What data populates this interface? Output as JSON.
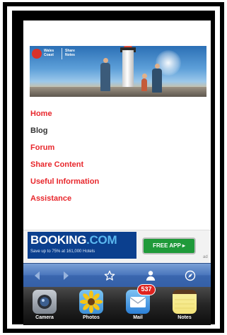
{
  "banner": {
    "logo_line1": "Wales",
    "logo_line2": "Coast",
    "share_line1": "Share",
    "share_line2": "Notes"
  },
  "nav": {
    "items": [
      {
        "label": "Home",
        "active": false
      },
      {
        "label": "Blog",
        "active": true
      },
      {
        "label": "Forum",
        "active": false
      },
      {
        "label": "Share Content",
        "active": false
      },
      {
        "label": "Useful Information",
        "active": false
      },
      {
        "label": "Assistance",
        "active": false
      }
    ]
  },
  "ad": {
    "brand": "BOOKING",
    "brand_suffix": ".COM",
    "tagline": "Save up to 75% at 161,000 Hotels",
    "cta": "FREE APP ▸",
    "mark": "ad"
  },
  "toolbar": {
    "icons": [
      "back-arrow-icon",
      "forward-arrow-icon",
      "bookmark-star-icon",
      "person-icon",
      "compass-icon"
    ]
  },
  "dock": {
    "apps": [
      {
        "label": "Camera",
        "icon": "camera-icon"
      },
      {
        "label": "Photos",
        "icon": "sunflower-photos-icon"
      },
      {
        "label": "Mail",
        "icon": "mail-envelope-icon",
        "badge": "537"
      },
      {
        "label": "Notes",
        "icon": "notes-pad-icon"
      }
    ]
  },
  "colors": {
    "nav_link": "#e8262b",
    "nav_active": "#333333",
    "toolbar": "#4b77bd",
    "booking_blue": "#0b3f8e",
    "cta_green": "#1f9a3a",
    "badge_red": "#e0231f"
  }
}
